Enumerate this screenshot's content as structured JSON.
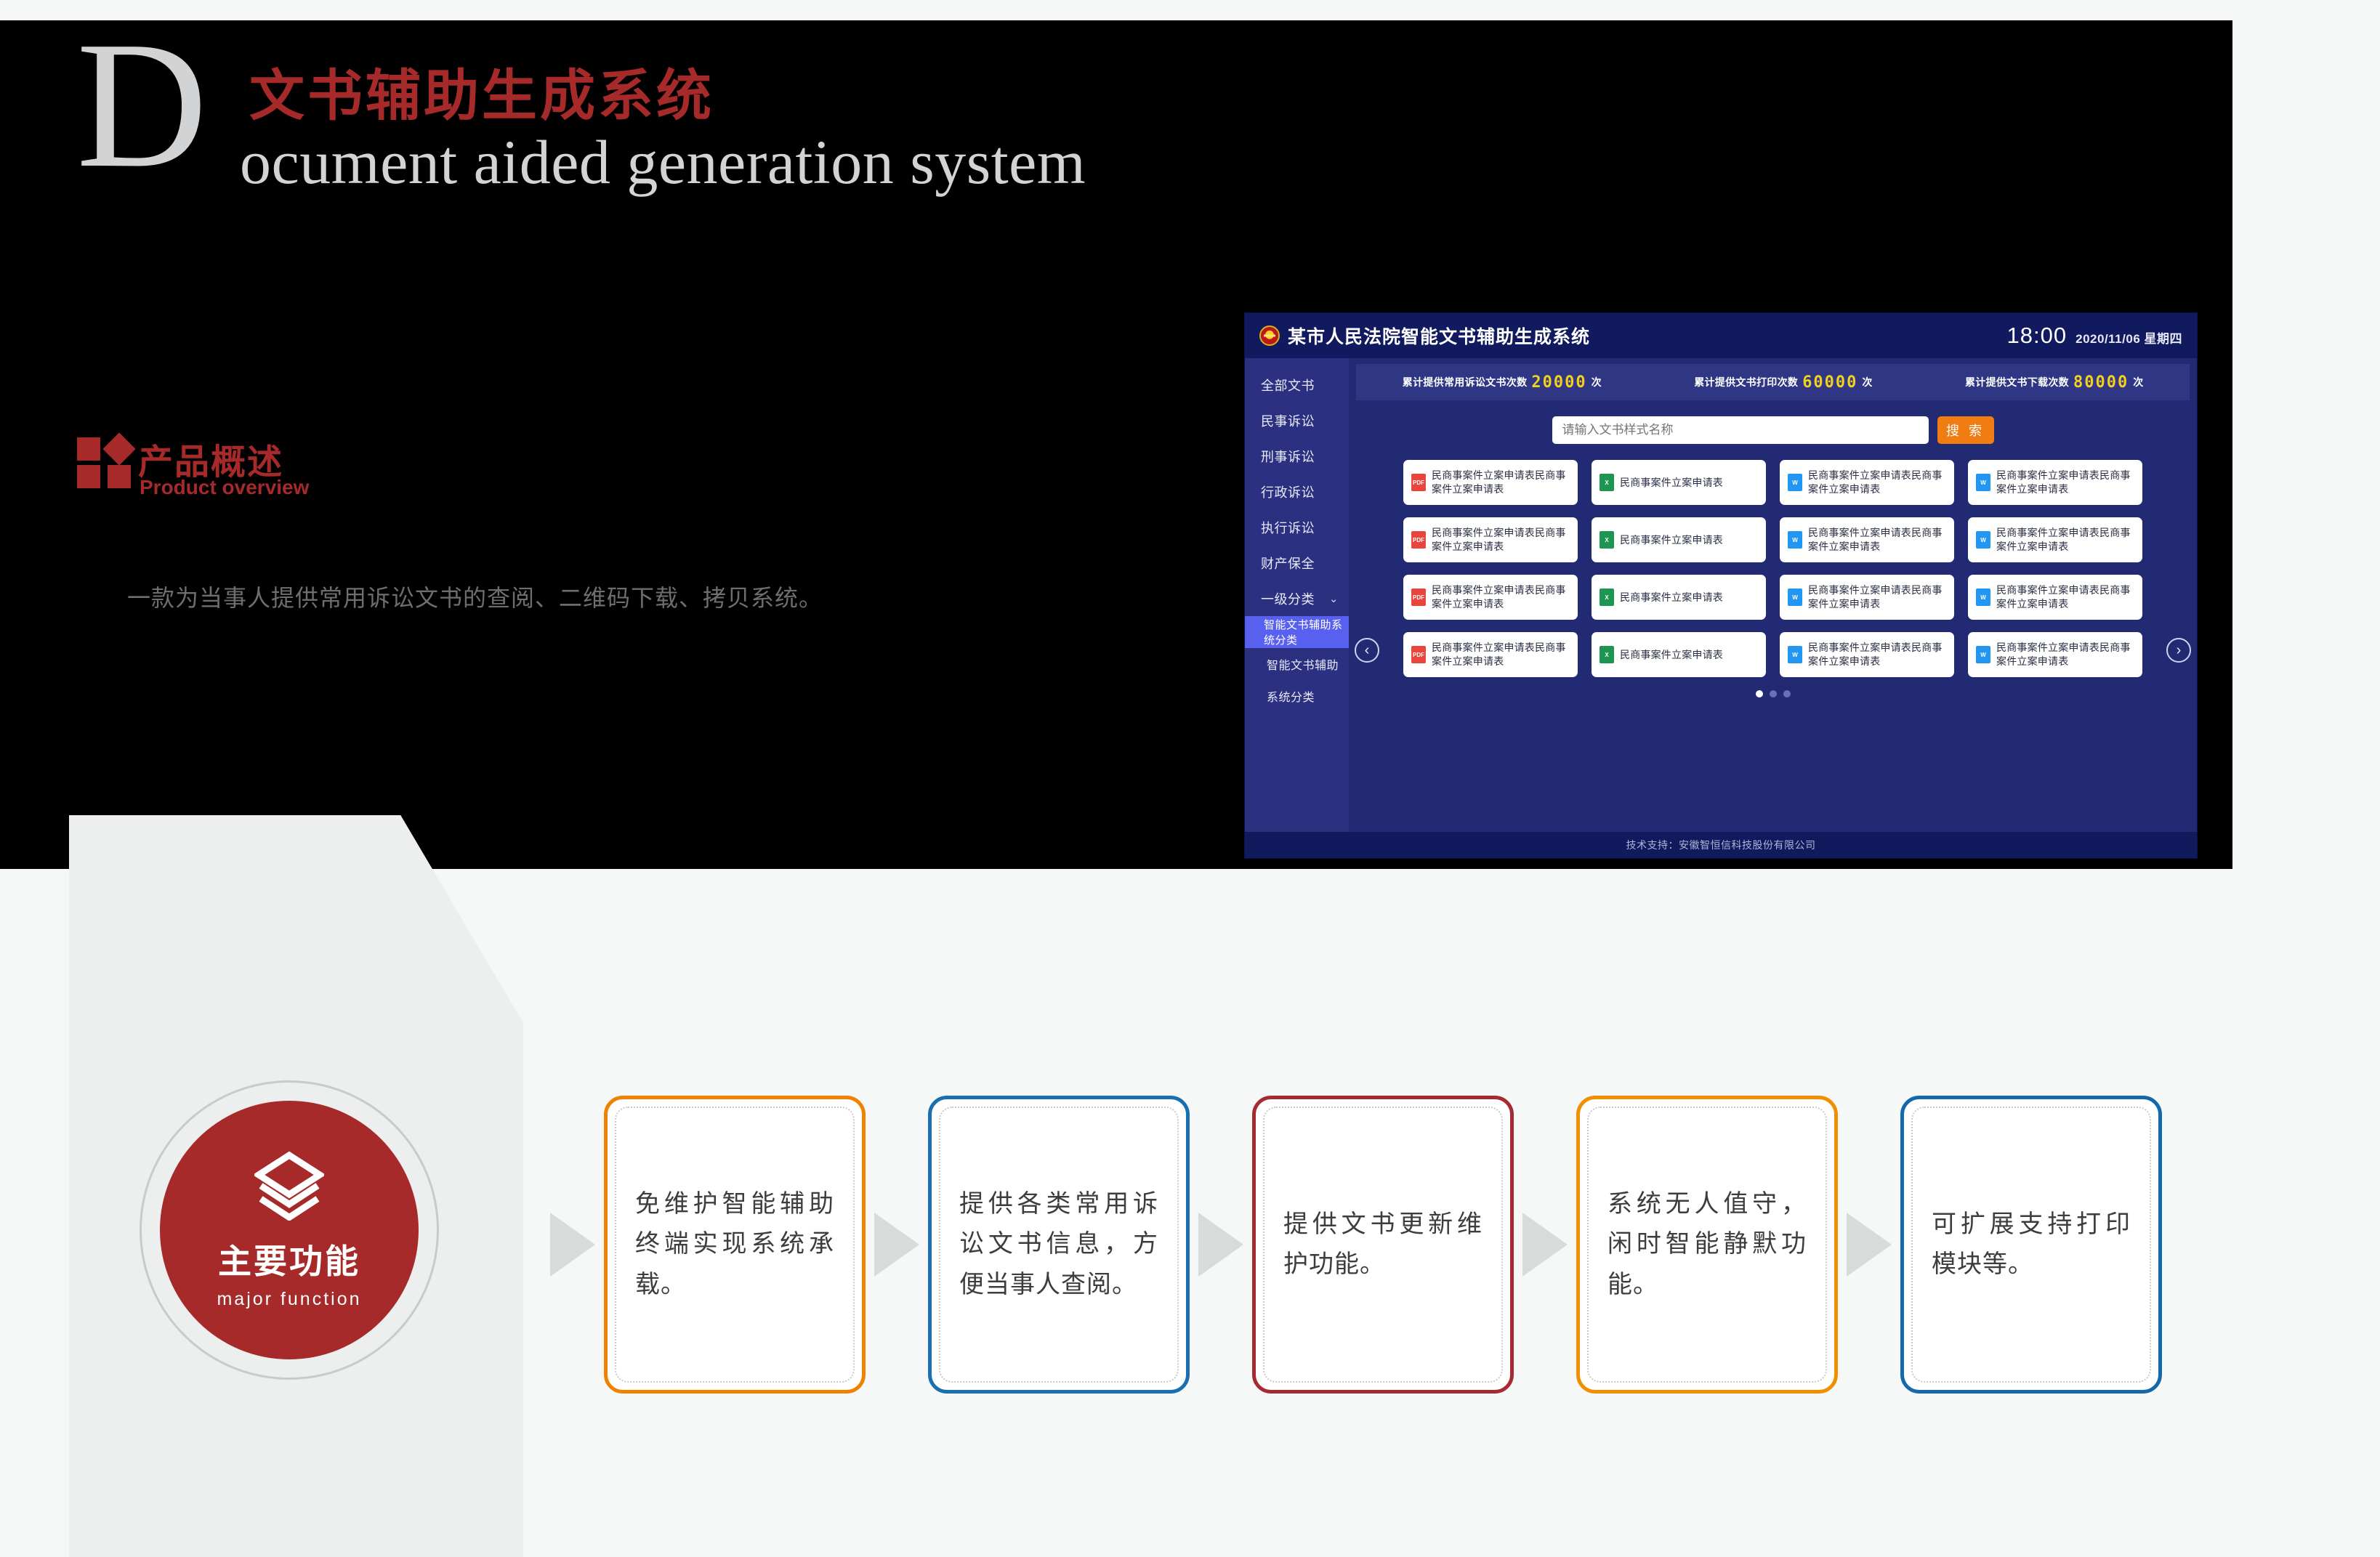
{
  "hero": {
    "drop_cap": "D",
    "title_cn": "文书辅助生成系统",
    "title_en": "ocument aided generation system"
  },
  "product_overview": {
    "title_cn": "产品概述",
    "title_en": "Product overview",
    "description": "一款为当事人提供常用诉讼文书的查阅、二维码下载、拷贝系统。"
  },
  "app": {
    "emblem_icon": "national-emblem-icon",
    "title": "某市人民法院智能文书辅助生成系统",
    "time": "18:00",
    "date": "2020/11/06 星期四",
    "sidebar": [
      {
        "label": "全部文书",
        "active": false,
        "sub": false,
        "chevron": false
      },
      {
        "label": "民事诉讼",
        "active": false,
        "sub": false,
        "chevron": false
      },
      {
        "label": "刑事诉讼",
        "active": false,
        "sub": false,
        "chevron": false
      },
      {
        "label": "行政诉讼",
        "active": false,
        "sub": false,
        "chevron": false
      },
      {
        "label": "执行诉讼",
        "active": false,
        "sub": false,
        "chevron": false
      },
      {
        "label": "财产保全",
        "active": false,
        "sub": false,
        "chevron": false
      },
      {
        "label": "一级分类",
        "active": false,
        "sub": false,
        "chevron": true
      },
      {
        "label": "智能文书辅助系统分类",
        "active": true,
        "sub": true,
        "chevron": false
      },
      {
        "label": "智能文书辅助",
        "active": false,
        "sub": true,
        "chevron": false
      },
      {
        "label": "系统分类",
        "active": false,
        "sub": true,
        "chevron": false
      }
    ],
    "stats": [
      {
        "label": "累计提供常用诉讼文书次数",
        "value": "20000",
        "unit": "次"
      },
      {
        "label": "累计提供文书打印次数",
        "value": "60000",
        "unit": "次"
      },
      {
        "label": "累计提供文书下载次数",
        "value": "80000",
        "unit": "次"
      }
    ],
    "search": {
      "placeholder": "请输入文书样式名称",
      "button_label": "搜 索"
    },
    "cards": [
      {
        "type": "pdf",
        "label": "民商事案件立案申请表民商事案件立案申请表"
      },
      {
        "type": "xls",
        "label": "民商事案件立案申请表"
      },
      {
        "type": "doc",
        "label": "民商事案件立案申请表民商事案件立案申请表"
      },
      {
        "type": "doc",
        "label": "民商事案件立案申请表民商事案件立案申请表"
      },
      {
        "type": "pdf",
        "label": "民商事案件立案申请表民商事案件立案申请表"
      },
      {
        "type": "xls",
        "label": "民商事案件立案申请表"
      },
      {
        "type": "doc",
        "label": "民商事案件立案申请表民商事案件立案申请表"
      },
      {
        "type": "doc",
        "label": "民商事案件立案申请表民商事案件立案申请表"
      },
      {
        "type": "pdf",
        "label": "民商事案件立案申请表民商事案件立案申请表"
      },
      {
        "type": "xls",
        "label": "民商事案件立案申请表"
      },
      {
        "type": "doc",
        "label": "民商事案件立案申请表民商事案件立案申请表"
      },
      {
        "type": "doc",
        "label": "民商事案件立案申请表民商事案件立案申请表"
      },
      {
        "type": "pdf",
        "label": "民商事案件立案申请表民商事案件立案申请表"
      },
      {
        "type": "xls",
        "label": "民商事案件立案申请表"
      },
      {
        "type": "doc",
        "label": "民商事案件立案申请表民商事案件立案申请表"
      },
      {
        "type": "doc",
        "label": "民商事案件立案申请表民商事案件立案申请表"
      }
    ],
    "prev_label": "‹",
    "next_label": "›",
    "pagination": {
      "count": 3,
      "active_index": 0
    },
    "footer": "技术支持：安徽智恒信科技股份有限公司"
  },
  "major_function": {
    "icon": "layers-icon",
    "title_cn": "主要功能",
    "title_en": "major function",
    "features": [
      {
        "text": "免维护智能辅助终端实现系统承载。",
        "color": "#ef8200"
      },
      {
        "text": "提供各类常用诉讼文书信息，方便当事人查阅。",
        "color": "#1a6fb0"
      },
      {
        "text": "提供文书更新维护功能。",
        "color": "#a62a33"
      },
      {
        "text": "系统无人值守，闲时智能静默功能。",
        "color": "#f09000"
      },
      {
        "text": "可扩展支持打印模块等。",
        "color": "#1469ad"
      }
    ]
  },
  "colors": {
    "brand_red": "#a62a2a",
    "hero_bg": "#000000",
    "app_bg": "#232a74",
    "accent_orange": "#f07c12",
    "accent_yellow": "#f2d020"
  }
}
